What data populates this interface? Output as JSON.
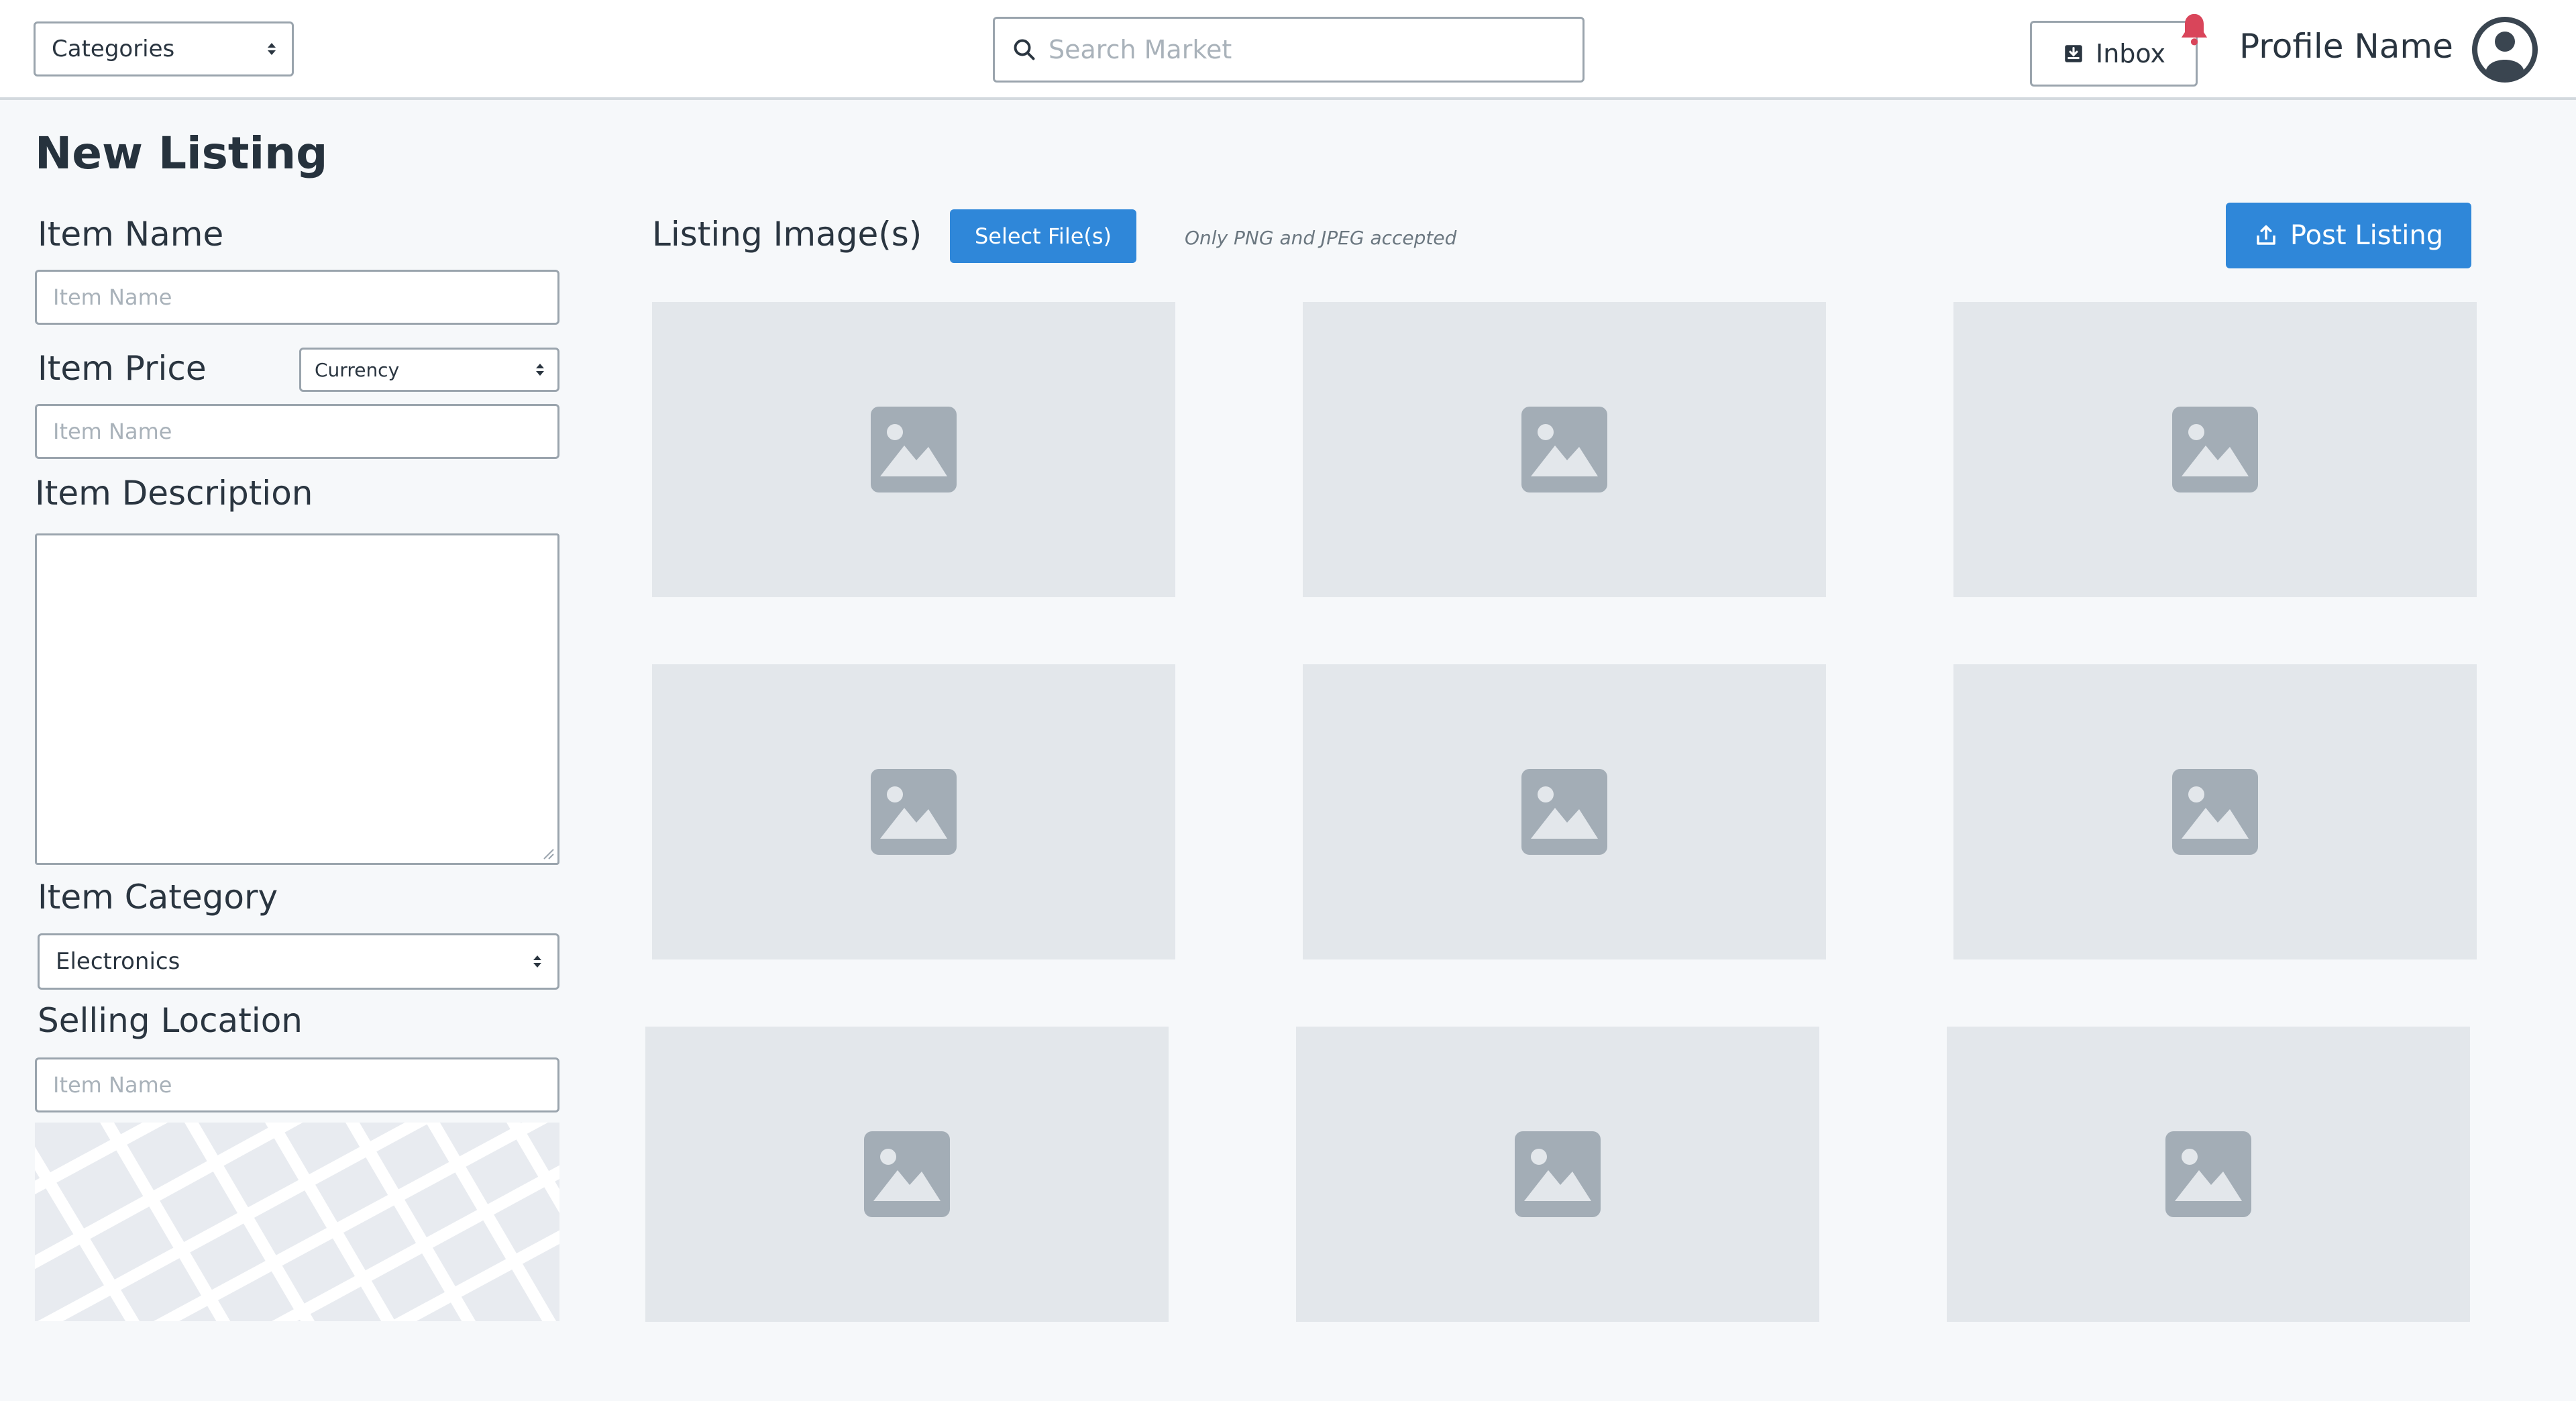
{
  "header": {
    "categories_label": "Categories",
    "search_placeholder": "Search Market",
    "inbox_label": "Inbox",
    "profile_name": "Profile Name"
  },
  "form": {
    "title": "New Listing",
    "item_name_label": "Item Name",
    "item_name_placeholder": "Item Name",
    "item_price_label": "Item Price",
    "currency_label": "Currency",
    "item_price_placeholder": "Item Name",
    "item_description_label": "Item Description",
    "item_category_label": "Item Category",
    "item_category_value": "Electronics",
    "selling_location_label": "Selling Location",
    "selling_location_placeholder": "Item Name"
  },
  "images": {
    "label": "Listing Image(s)",
    "select_button": "Select File(s)",
    "hint": "Only PNG and JPEG accepted",
    "post_button": "Post Listing",
    "slot_icon": "image-placeholder-icon"
  },
  "colors": {
    "primary": "#2f87d9",
    "notification": "#d9455a",
    "placeholder_bg": "#e3e7eb",
    "placeholder_icon": "#a3adb6"
  }
}
